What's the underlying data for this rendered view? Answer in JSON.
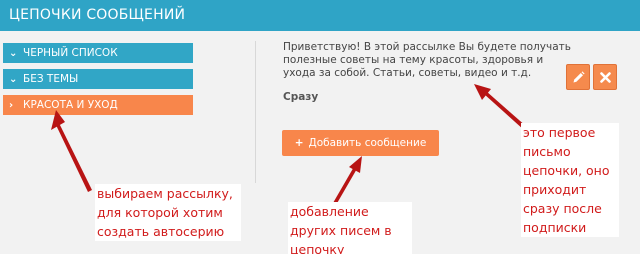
{
  "header": {
    "title": "ЦЕПОЧКИ СООБЩЕНИЙ"
  },
  "sidebar": {
    "items": [
      {
        "label": "ЧЕРНЫЙ СПИСОК",
        "icon": "chevron-down-icon",
        "active": false
      },
      {
        "label": "БЕЗ ТЕМЫ",
        "icon": "chevron-down-icon",
        "active": false
      },
      {
        "label": "КРАСОТА И УХОД",
        "icon": "chevron-right-icon",
        "active": true
      }
    ]
  },
  "message": {
    "text": "Приветствую! В этой рассылке Вы будете получать полезные советы на тему красоты, здоровья и ухода за собой. Статьи, советы, видео и т.д.",
    "timing": "Сразу"
  },
  "actions": {
    "edit_icon": "pencil-icon",
    "delete_icon": "close-icon",
    "add_message_label": "Добавить сообщение"
  },
  "annotations": {
    "first_letter": "это первое письмо цепочки, оно приходит сразу после подписки",
    "choose_list": "выбираем рассылку, для которой хотим создать автосерию",
    "add_letters": "добавление других писем в цепочку"
  },
  "colors": {
    "header": "#2fa4c6",
    "list_blue": "#31a6c6",
    "accent_orange": "#f8864b",
    "annotation_red": "#d11b1b",
    "arrow_red": "#b81414"
  }
}
